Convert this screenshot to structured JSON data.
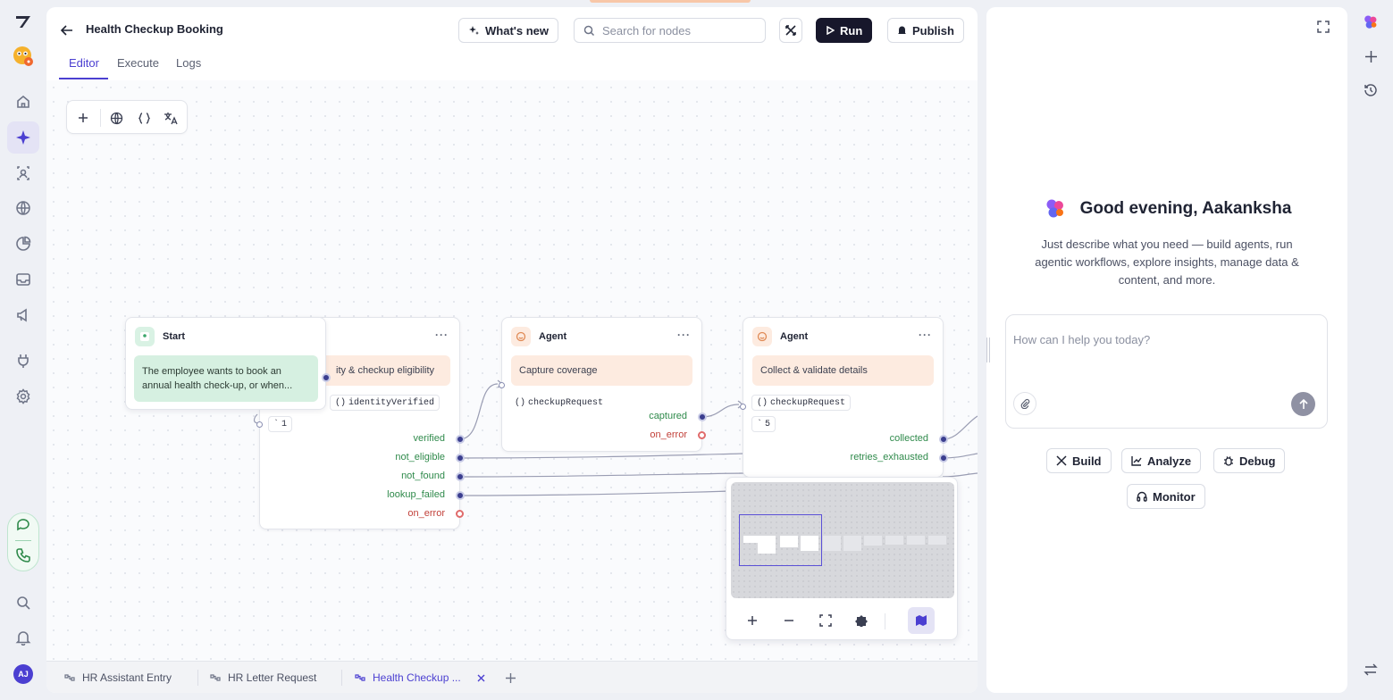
{
  "app": {
    "title": "Health Checkup Booking",
    "accent": "#4b3fd1"
  },
  "header": {
    "whats_new": "What's new",
    "search_placeholder": "Search for nodes",
    "run": "Run",
    "publish": "Publish"
  },
  "tabs": [
    "Editor",
    "Execute",
    "Logs"
  ],
  "active_tab": "Editor",
  "rail": {
    "user_initials": "AJ",
    "icons": [
      "home-icon",
      "agents-icon",
      "insights-icon",
      "globe-icon",
      "analytics-icon",
      "inbox-icon",
      "campaigns-icon",
      "plug-icon",
      "settings-icon",
      "chat-icon",
      "phone-icon",
      "search-icon",
      "bell-icon"
    ]
  },
  "nodes": {
    "start": {
      "label": "Start",
      "description": "The employee wants to book an annual health check-up, or when..."
    },
    "verify": {
      "description_fragment": "ity & checkup eligibility",
      "variable": "identityVerified",
      "count": "1",
      "outputs": [
        "verified",
        "not_eligible",
        "not_found",
        "lookup_failed"
      ],
      "error_output": "on_error"
    },
    "capture": {
      "label": "Agent",
      "description": "Capture coverage",
      "variable": "checkupRequest",
      "outputs": [
        "captured"
      ],
      "error_output": "on_error"
    },
    "collect": {
      "label": "Agent",
      "description": "Collect & validate details",
      "variable": "checkupRequest",
      "count": "5",
      "outputs": [
        "collected",
        "retries_exhausted"
      ]
    }
  },
  "bottom_tabs": [
    {
      "label": "HR Assistant Entry",
      "active": false
    },
    {
      "label": "HR Letter Request",
      "active": false
    },
    {
      "label": "Health Checkup ...",
      "active": true
    }
  ],
  "copilot": {
    "greeting": "Good evening, Aakanksha",
    "subtext": "Just describe what you need — build agents, run agentic workflows, explore insights, manage data & content, and more.",
    "input_placeholder": "How can I help you today?",
    "actions": [
      "Build",
      "Analyze",
      "Debug",
      "Monitor"
    ]
  }
}
